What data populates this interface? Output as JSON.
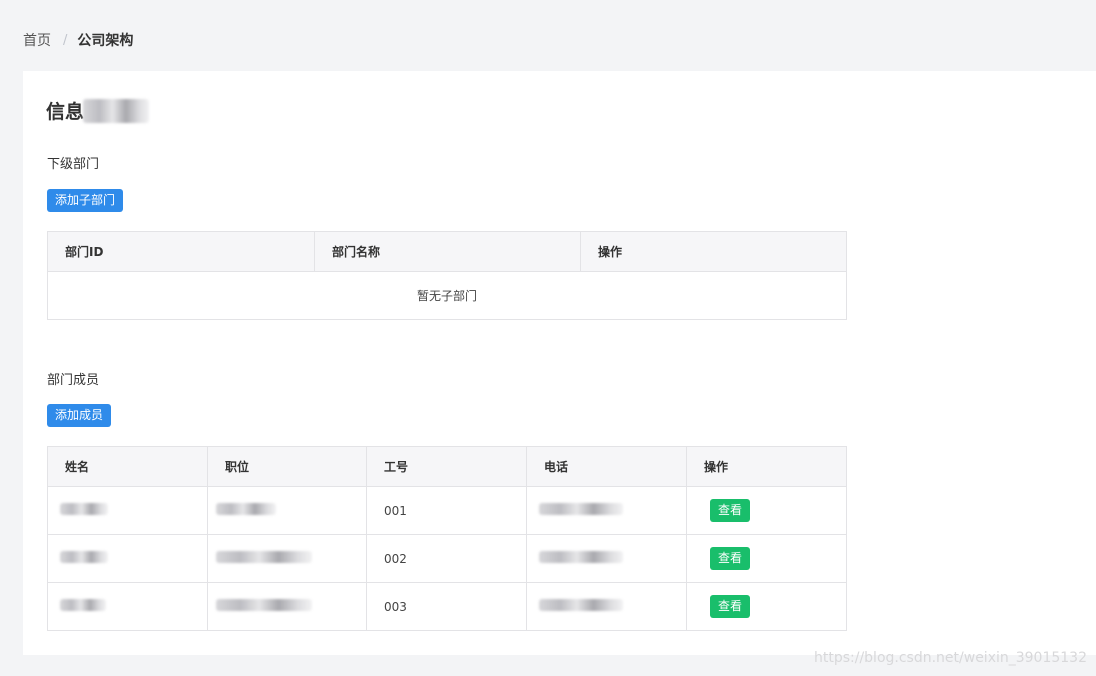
{
  "breadcrumb": {
    "home": "首页",
    "separator": "/",
    "current": "公司架构"
  },
  "page": {
    "title_visible": "信息",
    "title_redacted": true
  },
  "sub_departments": {
    "section_title": "下级部门",
    "add_button": "添加子部门",
    "columns": [
      "部门ID",
      "部门名称",
      "操作"
    ],
    "empty_text": "暂无子部门"
  },
  "members": {
    "section_title": "部门成员",
    "add_button": "添加成员",
    "columns": [
      "姓名",
      "职位",
      "工号",
      "电话",
      "操作"
    ],
    "rows": [
      {
        "employee_no": "001",
        "action": "查看"
      },
      {
        "employee_no": "002",
        "action": "查看"
      },
      {
        "employee_no": "003",
        "action": "查看"
      }
    ]
  },
  "watermark": "https://blog.csdn.net/weixin_39015132",
  "colors": {
    "primary": "#2f8bea",
    "success": "#19be6b",
    "background": "#f3f4f6"
  }
}
